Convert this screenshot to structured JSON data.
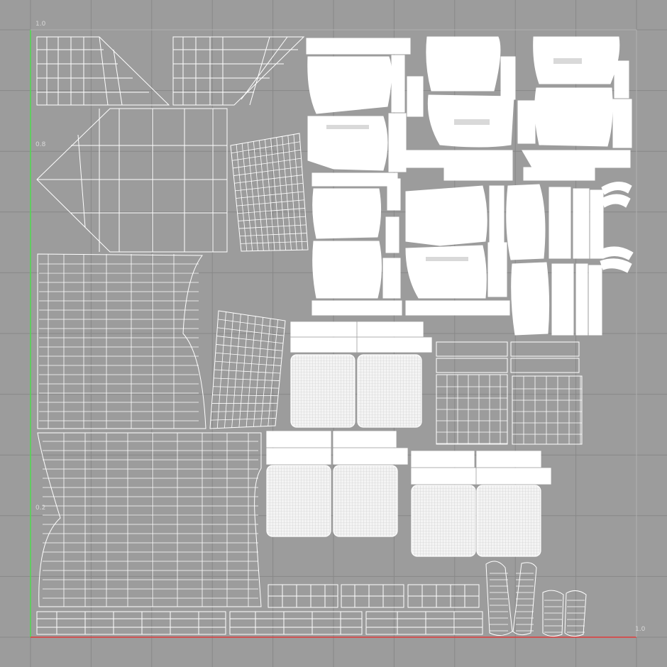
{
  "axis_labels": {
    "y_top": "1.0",
    "y_08": "0.8",
    "y_02": "0.2",
    "x_right": "1.0"
  },
  "colors": {
    "background": "#9c9c9c",
    "grid": "#878787",
    "wire": "#ffffff",
    "u_axis": "#e03b3b",
    "v_axis": "#4ddc4d"
  }
}
